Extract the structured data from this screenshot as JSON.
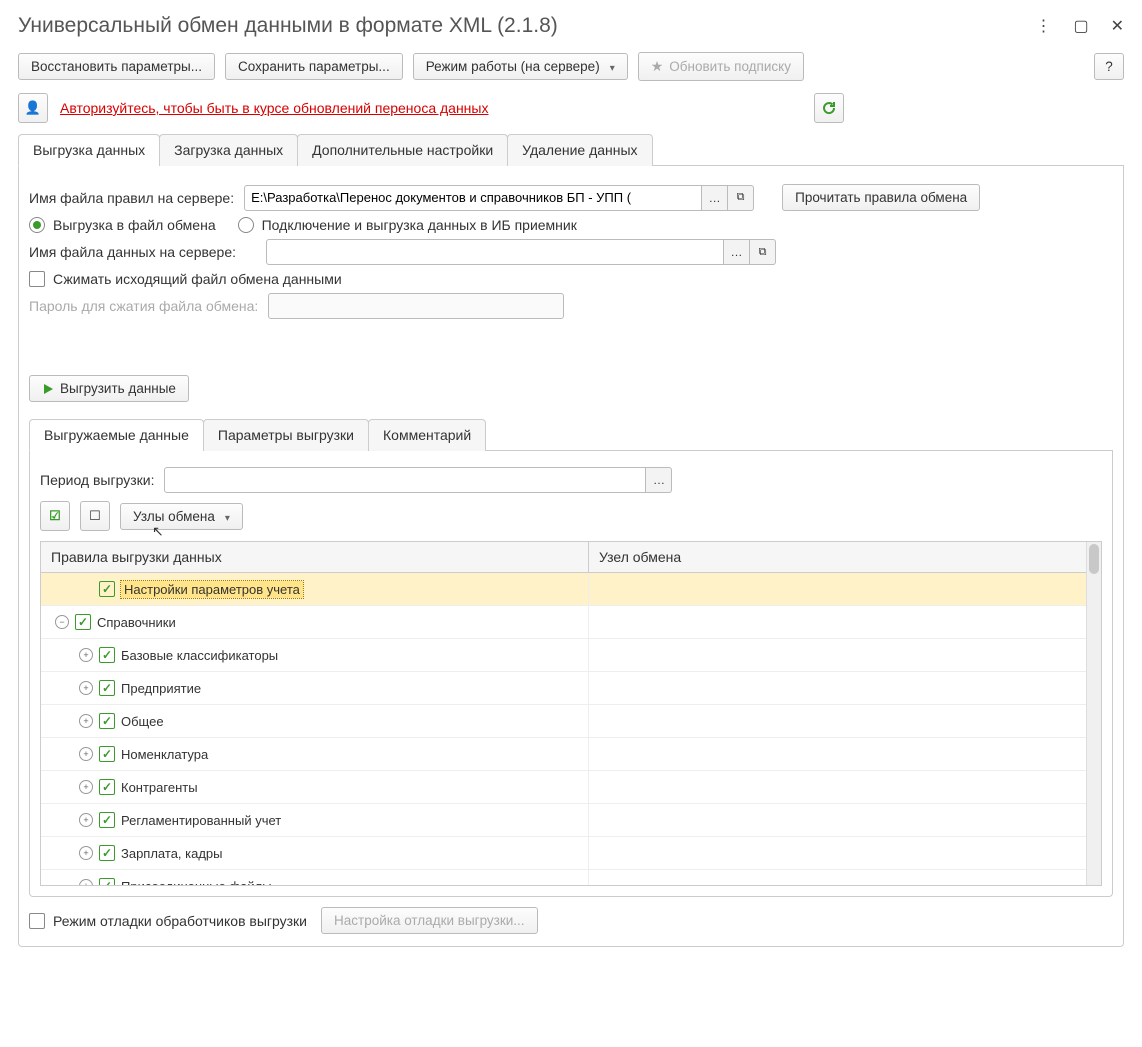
{
  "title": "Универсальный обмен данными в формате XML (2.1.8)",
  "toolbar": {
    "restore": "Восстановить параметры...",
    "save": "Сохранить параметры...",
    "mode": "Режим работы (на сервере)",
    "subscribe": "Обновить подписку",
    "help": "?"
  },
  "auth_link": "Авторизуйтесь, чтобы быть в курсе обновлений переноса данных",
  "tabs": {
    "export": "Выгрузка данных",
    "import": "Загрузка данных",
    "extra": "Дополнительные настройки",
    "delete": "Удаление данных"
  },
  "form": {
    "rules_label": "Имя файла правил на сервере:",
    "rules_value": "E:\\Разработка\\Перенос документов и справочников БП - УПП (",
    "read_rules": "Прочитать правила обмена",
    "radio_file": "Выгрузка в файл обмена",
    "radio_ib": "Подключение и выгрузка данных в ИБ приемник",
    "data_label": "Имя файла данных на сервере:",
    "data_value": "",
    "compress": "Сжимать исходящий файл обмена данными",
    "password_label": "Пароль для сжатия файла обмена:",
    "export_btn": "Выгрузить данные"
  },
  "subtabs": {
    "data": "Выгружаемые данные",
    "params": "Параметры выгрузки",
    "comment": "Комментарий"
  },
  "period": {
    "label": "Период выгрузки:",
    "value": ""
  },
  "nodes_btn": "Узлы обмена",
  "columns": {
    "rules": "Правила выгрузки данных",
    "node": "Узел обмена"
  },
  "rows": [
    {
      "indent": 1,
      "exp": "",
      "label": "Настройки параметров учета",
      "sel": true
    },
    {
      "indent": 0,
      "exp": "−",
      "label": "Справочники"
    },
    {
      "indent": 1,
      "exp": "+",
      "label": "Базовые классификаторы"
    },
    {
      "indent": 1,
      "exp": "+",
      "label": "Предприятие"
    },
    {
      "indent": 1,
      "exp": "+",
      "label": "Общее"
    },
    {
      "indent": 1,
      "exp": "+",
      "label": "Номенклатура"
    },
    {
      "indent": 1,
      "exp": "+",
      "label": "Контрагенты"
    },
    {
      "indent": 1,
      "exp": "+",
      "label": "Регламентированный учет"
    },
    {
      "indent": 1,
      "exp": "+",
      "label": "Зарплата, кадры"
    },
    {
      "indent": 1,
      "exp": "+",
      "label": "Присоединенные файлы"
    }
  ],
  "footer": {
    "debug": "Режим отладки обработчиков выгрузки",
    "debug_btn": "Настройка отладки выгрузки..."
  }
}
